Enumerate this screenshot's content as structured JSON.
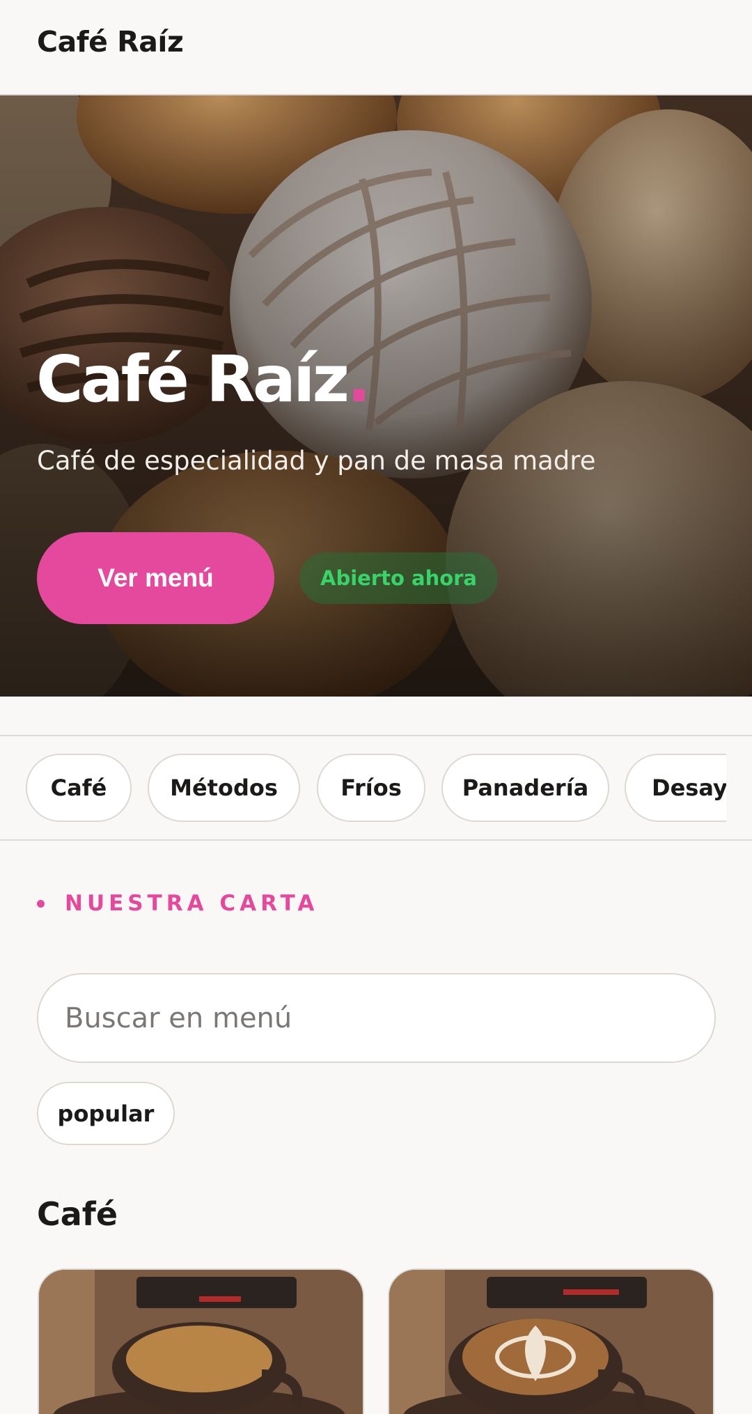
{
  "header": {
    "brand": "Café Raíz"
  },
  "hero": {
    "title": "Café Raíz",
    "title_dot": ".",
    "subtitle": "Café de especialidad y pan de masa madre",
    "cta_label": "Ver menú",
    "status_badge": "Abierto ahora"
  },
  "categories": [
    "Café",
    "Métodos",
    "Fríos",
    "Panadería",
    "Desayunos"
  ],
  "menu": {
    "eyebrow": "NUESTRA CARTA",
    "search_placeholder": "Buscar en menú",
    "filter_tag": "popular",
    "section_heading": "Café"
  },
  "colors": {
    "accent": "#e4499d",
    "open_green": "#3ad36a",
    "background": "#f9f8f6"
  }
}
